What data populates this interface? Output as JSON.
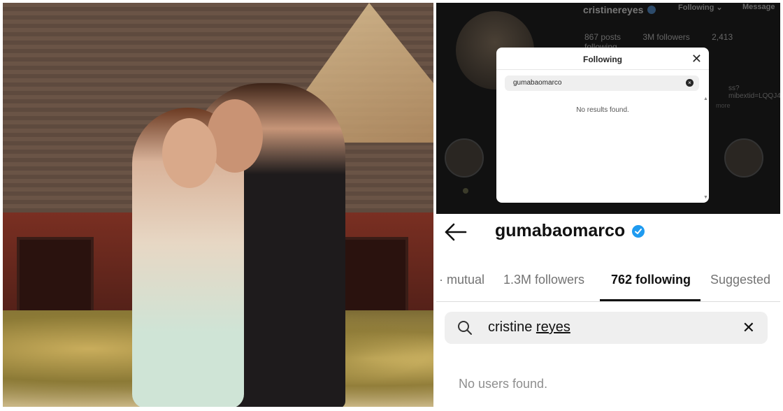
{
  "dark_profile": {
    "username": "cristinereyes",
    "following_button": "Following ⌄",
    "message_button": "Message",
    "stats": [
      "867 posts",
      "3M followers",
      "2,413 following"
    ],
    "link_fragment": "ss?mibextid=LQQJ4d",
    "more_fragment": "more"
  },
  "modal": {
    "title": "Following",
    "close_glyph": "✕",
    "search_value": "gumabaomarco",
    "clear_glyph": "×",
    "empty_message": "No results found."
  },
  "profile": {
    "username": "gumabaomarco",
    "tabs": [
      {
        "label": "mutual"
      },
      {
        "label": "1.3M followers"
      },
      {
        "label": "762 following"
      },
      {
        "label": "Suggested"
      }
    ],
    "search_value_first": "cristine",
    "search_value_second": "reyes",
    "clear_glyph": "✕",
    "empty_message": "No users found."
  },
  "colors": {
    "verified": "#1f9bf0",
    "dark_bg": "#111111"
  },
  "icons": [
    "back-arrow-icon",
    "verified-badge-icon",
    "search-icon",
    "close-icon",
    "clear-icon"
  ]
}
